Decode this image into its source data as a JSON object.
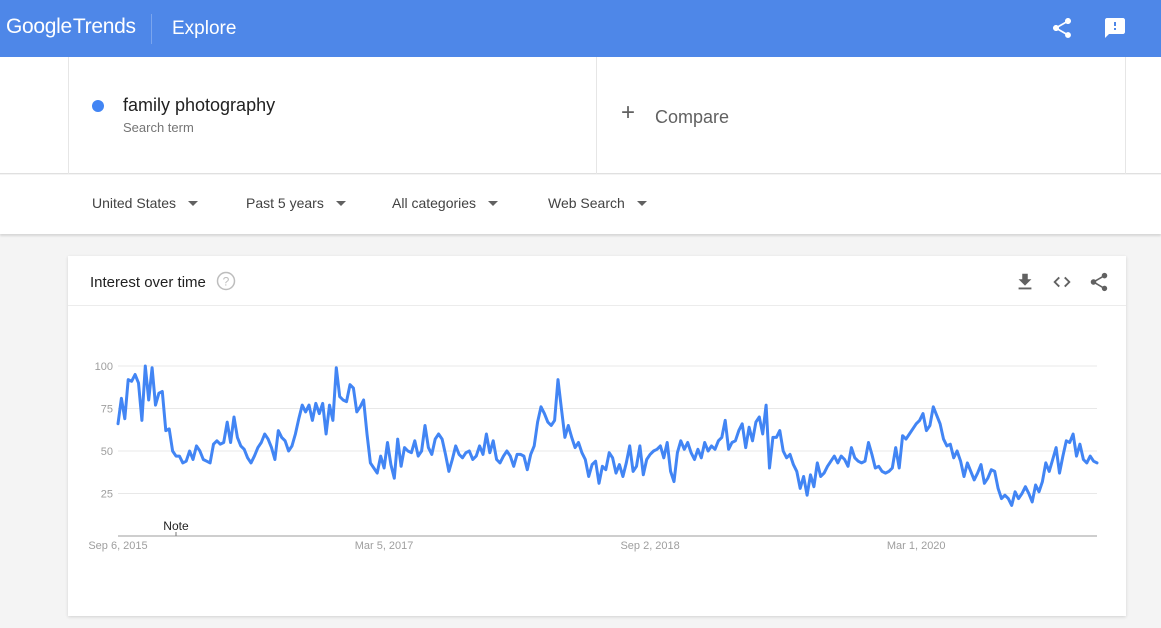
{
  "header": {
    "logo_google": "Google",
    "logo_trends": "Trends",
    "section": "Explore",
    "icons": [
      "share-icon",
      "feedback-icon"
    ],
    "brand_color": "#4e87e8"
  },
  "search": {
    "term": "family photography",
    "term_sublabel": "Search term",
    "term_color": "#4285f4",
    "compare_label": "Compare",
    "compare_icon": "plus-icon"
  },
  "filters": [
    {
      "label": "United States"
    },
    {
      "label": "Past 5 years"
    },
    {
      "label": "All categories"
    },
    {
      "label": "Web Search"
    }
  ],
  "card": {
    "title": "Interest over time",
    "icons": [
      "help-icon",
      "download-icon",
      "embed-code-icon",
      "share-icon"
    ]
  },
  "chart_data": {
    "type": "line",
    "title": "Interest over time",
    "xlabel": "",
    "ylabel": "",
    "ylim": [
      0,
      100
    ],
    "yticks": [
      25,
      50,
      75,
      100
    ],
    "xtick_labels": [
      "Sep 6, 2015",
      "Mar 5, 2017",
      "Sep 2, 2018",
      "Mar 1, 2020"
    ],
    "xtick_week_index": [
      0,
      78,
      156,
      234
    ],
    "annotation": "Note",
    "annotation_week_index": 17,
    "grid": true,
    "series": [
      {
        "name": "family photography",
        "color": "#4285f4",
        "values": [
          66,
          81,
          69,
          92,
          91,
          95,
          90,
          68,
          100,
          80,
          99,
          77,
          84,
          85,
          62,
          63,
          50,
          47,
          47,
          43,
          44,
          50,
          45,
          53,
          50,
          45,
          44,
          43,
          54,
          56,
          54,
          55,
          67,
          55,
          70,
          58,
          53,
          51,
          46,
          43,
          47,
          52,
          55,
          60,
          57,
          52,
          45,
          62,
          58,
          56,
          50,
          53,
          60,
          69,
          77,
          73,
          77,
          68,
          78,
          72,
          78,
          60,
          77,
          68,
          99,
          82,
          80,
          79,
          89,
          87,
          73,
          76,
          80,
          60,
          43,
          40,
          37,
          47,
          40,
          55,
          42,
          34,
          57,
          41,
          52,
          50,
          49,
          56,
          47,
          50,
          65,
          52,
          48,
          57,
          60,
          57,
          48,
          38,
          45,
          53,
          48,
          46,
          49,
          50,
          45,
          47,
          53,
          48,
          60,
          49,
          56,
          45,
          43,
          47,
          50,
          47,
          41,
          48,
          48,
          47,
          39,
          48,
          53,
          67,
          76,
          72,
          67,
          65,
          68,
          92,
          75,
          58,
          65,
          58,
          52,
          55,
          49,
          45,
          35,
          42,
          44,
          31,
          41,
          39,
          49,
          46,
          37,
          42,
          35,
          43,
          53,
          38,
          41,
          53,
          36,
          45,
          48,
          50,
          51,
          53,
          46,
          55,
          38,
          32,
          49,
          56,
          51,
          55,
          49,
          45,
          51,
          46,
          55,
          50,
          53,
          51,
          56,
          58,
          68,
          51,
          55,
          56,
          62,
          66,
          52,
          64,
          56,
          67,
          70,
          60,
          77,
          40,
          58,
          58,
          62,
          50,
          46,
          48,
          42,
          38,
          28,
          35,
          24,
          36,
          29,
          43,
          35,
          37,
          41,
          44,
          47,
          43,
          47,
          45,
          41,
          52,
          46,
          44,
          43,
          44,
          55,
          48,
          40,
          41,
          38,
          37,
          38,
          40,
          52,
          40,
          59,
          57,
          60,
          63,
          66,
          68,
          72,
          62,
          65,
          76,
          71,
          66,
          57,
          53,
          54,
          46,
          50,
          44,
          35,
          43,
          38,
          33,
          37,
          42,
          31,
          34,
          39,
          38,
          28,
          22,
          24,
          22,
          18,
          26,
          22,
          25,
          29,
          25,
          20,
          30,
          26,
          32,
          43,
          38,
          45,
          52,
          37,
          47,
          56,
          55,
          60,
          47,
          54,
          45,
          43,
          47,
          44,
          43
        ]
      }
    ]
  }
}
